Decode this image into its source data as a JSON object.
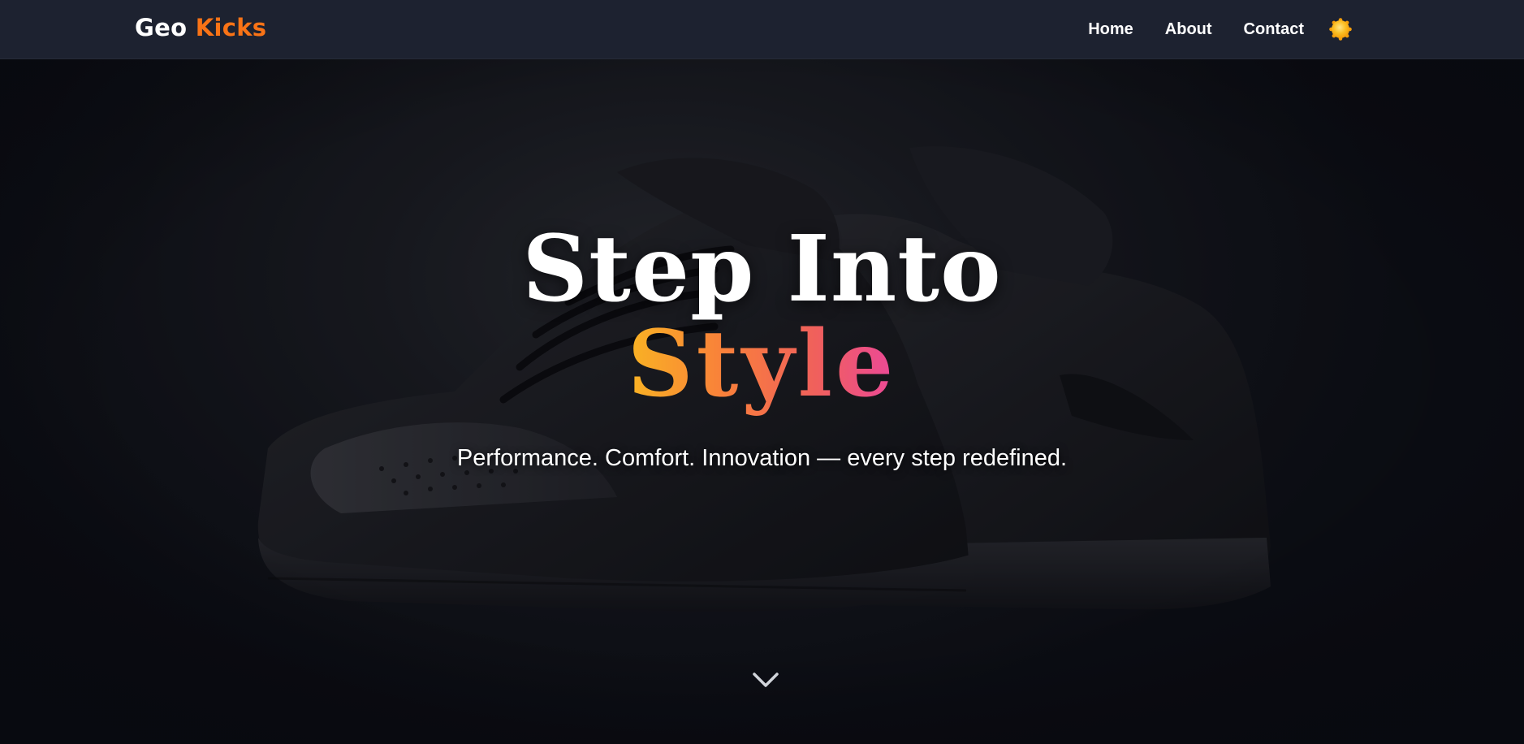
{
  "brand": {
    "name": "Geo",
    "accent": "Kicks",
    "accent_color": "#f97316"
  },
  "nav": {
    "links": [
      {
        "label": "Home"
      },
      {
        "label": "About"
      },
      {
        "label": "Contact"
      }
    ],
    "theme_toggle_icon": "sun-icon"
  },
  "hero": {
    "title": "Step Into",
    "title_accent": "Style",
    "subtitle": "Performance. Comfort. Innovation — every step redefined.",
    "image": "black-sneakers-photo",
    "scroll_icon": "chevron-down-icon",
    "gradient_colors": [
      "#f9b323",
      "#f9813a",
      "#f0605c",
      "#ec4899"
    ]
  }
}
